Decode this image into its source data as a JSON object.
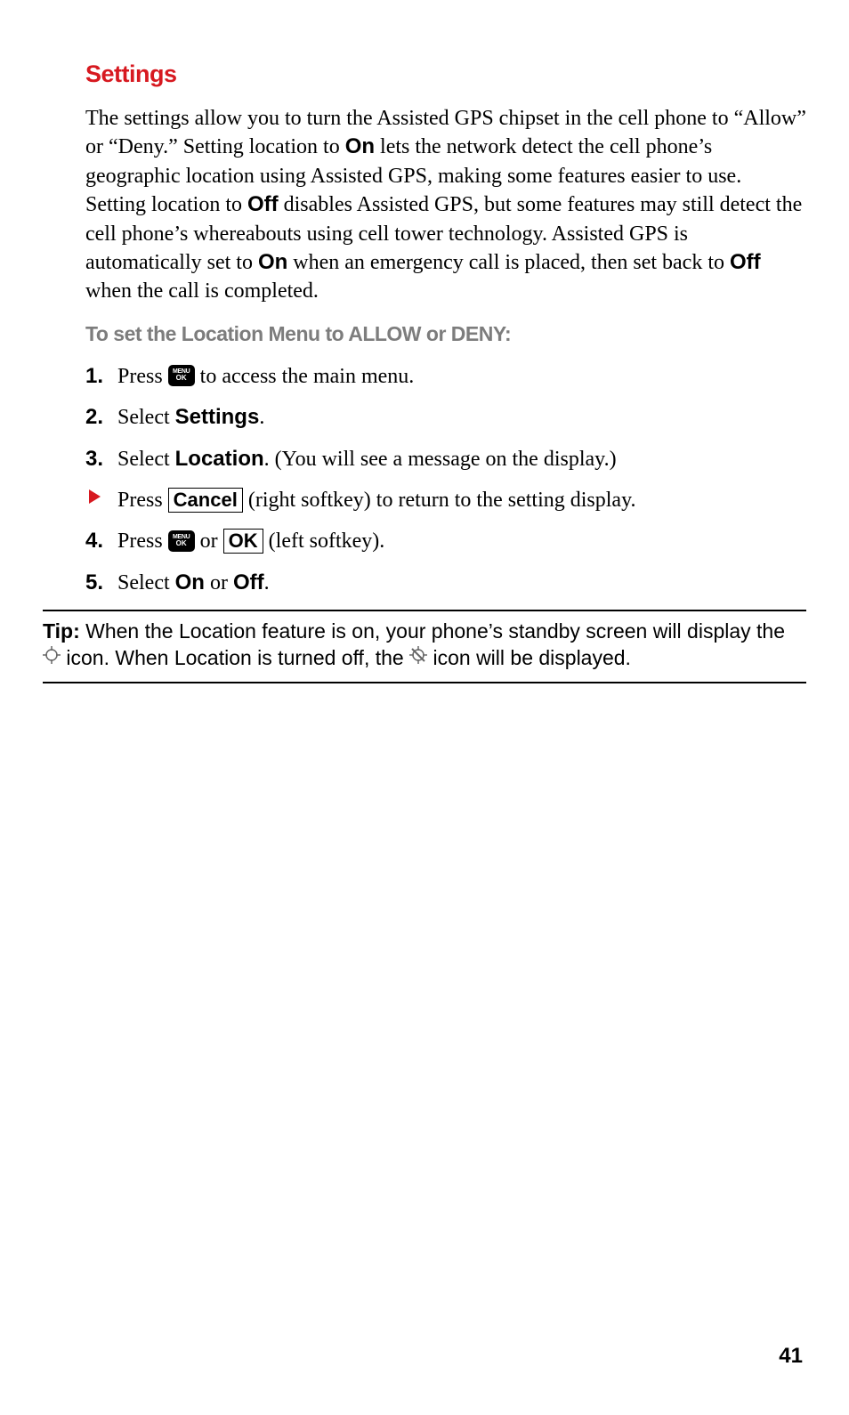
{
  "heading": "Settings",
  "para1_pre": "The settings allow you to turn the Assisted GPS chipset in the cell phone to “Allow” or “Deny.” Setting location to ",
  "para1_bold1": "On",
  "para1_mid1": " lets the network detect the cell phone’s geographic location using Assisted GPS, making some features easier to use. Setting location to ",
  "para1_bold2": "Off",
  "para1_mid2": " disables Assisted GPS, but some features may still detect the cell phone’s whereabouts using cell tower technology. Assisted GPS is automatically set to ",
  "para1_bold3": "On",
  "para1_mid3": " when an emergency call is placed, then set back to ",
  "para1_bold4": "Off",
  "para1_end": " when the call is completed.",
  "subhead": "To set the Location Menu to ALLOW or DENY:",
  "step1_num": "1.",
  "step1_pre": " Press ",
  "menuok_l1": "MENU",
  "menuok_l2": "OK",
  "step1_post": " to access the main menu.",
  "step2_num": "2.",
  "step2_pre": " Select ",
  "step2_bold": "Settings",
  "step2_post": ".",
  "step3_num": "3.",
  "step3_pre": " Select ",
  "step3_bold": "Location",
  "step3_post": ". (You will see a message on the display.)",
  "bullet_pre": "Press ",
  "bullet_box": "Cancel",
  "bullet_post": " (right softkey) to return to the setting display.",
  "step4_num": "4.",
  "step4_pre": " Press ",
  "step4_mid": " or ",
  "step4_box": "OK",
  "step4_post": " (left softkey).",
  "step5_num": "5.",
  "step5_pre": " Select ",
  "step5_bold1": "On",
  "step5_mid": " or ",
  "step5_bold2": "Off",
  "step5_post": ".",
  "tip_label": "Tip:",
  "tip_pre": " When the Location feature is on, your phone’s standby screen will display the ",
  "tip_mid": " icon. When Location is turned off, the ",
  "tip_post": " icon will be displayed.",
  "page_number": "41"
}
